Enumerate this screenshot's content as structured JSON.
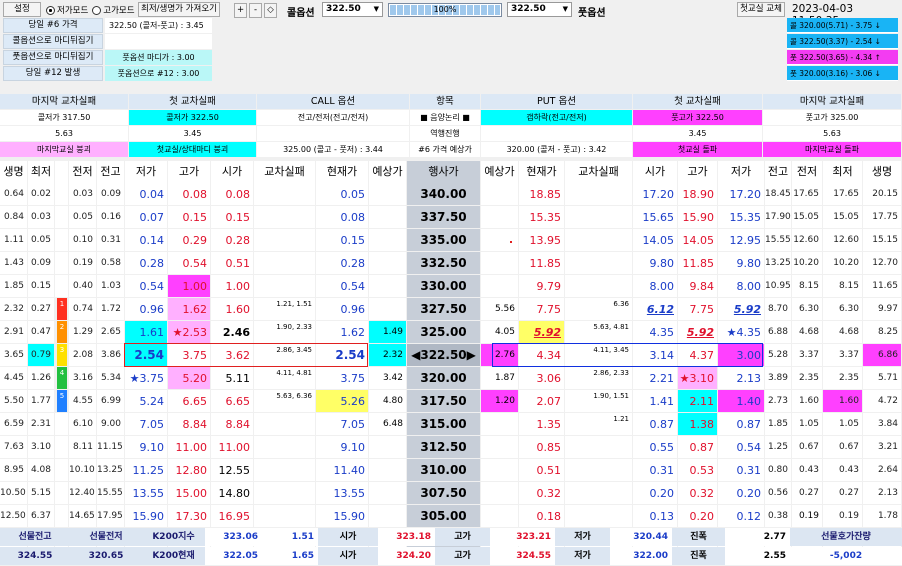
{
  "top": {
    "settings": "설정",
    "mode_low": "저가모드",
    "mode_high": "고가모드",
    "fetch_btn": "최저/생명가 가져오기",
    "plus": "+",
    "minus": "-",
    "diamond": "◇",
    "call_label": "콜옵션",
    "call_value": "322.50",
    "zoom": "100%",
    "put_value": "322.50",
    "put_label": "풋옵션",
    "replace_btn": "첫교실 교체",
    "datetime": "2023-04-03 11:50:35"
  },
  "info_rows": [
    {
      "label": "당일 #6 가격",
      "value": "322.50 (콜저-풋고) : 3.45",
      "hl": false
    },
    {
      "label": "콜옵션으로 마디뒤집기",
      "value": "",
      "hl": false
    },
    {
      "label": "풋옵션으로 마디뒤집기",
      "value": "풋옵션 마디가 : 3.00",
      "hl": true
    },
    {
      "label": "당일 #12 발생",
      "value": "풋옵션으로 #12 : 3.00",
      "hl": true
    }
  ],
  "side_list": [
    {
      "text": "콜 320.00(5.71) - 3.75 ↓",
      "color": "#19b4f5"
    },
    {
      "text": "콜 322.50(3.37) - 2.54 ↓",
      "color": "#19b4f5"
    },
    {
      "text": "풋 322.50(3.65) - 4.34 ↑",
      "color": "#f33cf2"
    },
    {
      "text": "풋 320.00(3.16) - 3.06 ↓",
      "color": "#19b4f5"
    }
  ],
  "header": {
    "row1": [
      "마지막 교차실패",
      "첫 교차실패",
      "CALL 옵션",
      "항목",
      "PUT 옵션",
      "첫 교차실패",
      "마지막 교차실패"
    ],
    "row2": [
      "콜저가 317.50",
      "콜저가 322.50",
      "전고/전저(전고/전저)",
      "■ 음양논리 ■",
      "갭하락(전고/전저)",
      "풋고가 322.50",
      "풋고가 325.00"
    ],
    "row3": [
      "5.63",
      "3.45",
      "",
      "역행진행",
      "",
      "3.45",
      "5.63"
    ],
    "row4": [
      "마지막교실 붕괴",
      "첫교실/상대마디 붕괴",
      "325.00 (콜고 - 풋저) : 3.44",
      "#6 가격 예상가",
      "320.00 (콜저 - 풋고) : 3.42",
      "첫교실 돌파",
      "마지막교실 돌파"
    ]
  },
  "cols": [
    "생명",
    "최저",
    "",
    "전저",
    "전고",
    "저가",
    "고가",
    "시가",
    "교차실패",
    "현재가",
    "예상가",
    "행사가",
    "예상가",
    "현재가",
    "교차실패",
    "시가",
    "고가",
    "저가",
    "전고",
    "전저",
    "최저",
    "생명"
  ],
  "rows": [
    {
      "strike": "340.00",
      "c": [
        "0.64",
        "0.02",
        "",
        "0.03",
        "0.09",
        "0.04",
        "0.08",
        "0.08",
        "",
        "0.05",
        ""
      ],
      "p": [
        "",
        "18.85",
        "",
        "17.20",
        "18.90",
        "17.20",
        "18.45",
        "17.65",
        "17.65",
        "20.15"
      ]
    },
    {
      "strike": "337.50",
      "c": [
        "0.84",
        "0.03",
        "",
        "0.05",
        "0.16",
        "0.07",
        "0.15",
        "0.15",
        "",
        "0.08",
        ""
      ],
      "p": [
        "",
        "15.35",
        "",
        "15.65",
        "15.90",
        "15.35",
        "17.90",
        "15.05",
        "15.05",
        "17.75"
      ]
    },
    {
      "strike": "335.00",
      "c": [
        "1.11",
        "0.05",
        "",
        "0.10",
        "0.31",
        "0.14",
        "0.29",
        "0.28",
        "",
        "0.15",
        ""
      ],
      "p": [
        "",
        "13.95",
        "",
        "14.05",
        "14.05",
        "12.95",
        "15.55",
        "12.60",
        "12.60",
        "15.15"
      ]
    },
    {
      "strike": "332.50",
      "c": [
        "1.43",
        "0.09",
        "",
        "0.19",
        "0.58",
        "0.28",
        "0.54",
        "0.51",
        "",
        "0.28",
        ""
      ],
      "p": [
        "",
        "11.85",
        "",
        "9.80",
        "11.85",
        "9.80",
        "13.25",
        "10.20",
        "10.20",
        "12.70"
      ]
    },
    {
      "strike": "330.00",
      "c": [
        "1.85",
        "0.15",
        "",
        "0.40",
        "1.03",
        "0.54",
        "1.00",
        "1.00",
        "",
        "0.54",
        ""
      ],
      "p": [
        "",
        "9.79",
        "",
        "8.00",
        "9.84",
        "8.00",
        "10.95",
        "8.15",
        "8.15",
        "11.65"
      ]
    },
    {
      "strike": "327.50",
      "c": [
        "2.32",
        "0.27",
        "1",
        "0.74",
        "1.72",
        "0.96",
        "1.62",
        "1.60",
        "1.21, 1.51",
        "0.96",
        ""
      ],
      "p": [
        "5.56",
        "7.75",
        "6.36",
        "6.12",
        "7.75",
        "5.92",
        "8.70",
        "6.30",
        "6.30",
        "9.97"
      ]
    },
    {
      "strike": "325.00",
      "c": [
        "2.91",
        "0.47",
        "2",
        "1.29",
        "2.65",
        "1.61",
        "★2.53",
        "2.46",
        "1.90, 2.33",
        "1.62",
        "1.49"
      ],
      "p": [
        "4.05",
        "5.92",
        "5.63, 4.81",
        "4.35",
        "5.92",
        "★4.35",
        "6.88",
        "4.68",
        "4.68",
        "8.25"
      ]
    },
    {
      "strike": "◀322.50▶",
      "c": [
        "3.65",
        "0.79",
        "3",
        "2.08",
        "3.86",
        "2.54",
        "3.75",
        "3.62",
        "2.86, 3.45",
        "2.54",
        "2.32"
      ],
      "p": [
        "2.76",
        "4.34",
        "4.11, 3.45",
        "3.14",
        "4.37",
        "3.00",
        "5.28",
        "3.37",
        "3.37",
        "6.86"
      ]
    },
    {
      "strike": "320.00",
      "c": [
        "4.45",
        "1.26",
        "4",
        "3.16",
        "5.34",
        "★3.75",
        "5.20",
        "5.11",
        "4.11, 4.81",
        "3.75",
        "3.42"
      ],
      "p": [
        "1.87",
        "3.06",
        "2.86, 2.33",
        "2.21",
        "★3.10",
        "2.13",
        "3.89",
        "2.35",
        "2.35",
        "5.71"
      ]
    },
    {
      "strike": "317.50",
      "c": [
        "5.50",
        "1.77",
        "5",
        "4.55",
        "6.99",
        "5.24",
        "6.65",
        "6.65",
        "5.63, 6.36",
        "5.26",
        "4.80"
      ],
      "p": [
        "1.20",
        "2.07",
        "1.90, 1.51",
        "1.41",
        "2.11",
        "1.40",
        "2.73",
        "1.60",
        "1.60",
        "4.72"
      ]
    },
    {
      "strike": "315.00",
      "c": [
        "6.59",
        "2.31",
        "",
        "6.10",
        "9.00",
        "7.05",
        "8.84",
        "8.84",
        "",
        "7.05",
        "6.48"
      ],
      "p": [
        "",
        "1.35",
        "1.21",
        "0.87",
        "1.38",
        "0.87",
        "1.85",
        "1.05",
        "1.05",
        "3.84"
      ]
    },
    {
      "strike": "312.50",
      "c": [
        "7.63",
        "3.10",
        "",
        "8.11",
        "11.15",
        "9.10",
        "11.00",
        "11.00",
        "",
        "9.10",
        ""
      ],
      "p": [
        "",
        "0.85",
        "",
        "0.55",
        "0.87",
        "0.54",
        "1.25",
        "0.67",
        "0.67",
        "3.21"
      ]
    },
    {
      "strike": "310.00",
      "c": [
        "8.95",
        "4.08",
        "",
        "10.10",
        "13.25",
        "11.25",
        "12.80",
        "12.55",
        "",
        "11.40",
        ""
      ],
      "p": [
        "",
        "0.51",
        "",
        "0.31",
        "0.53",
        "0.31",
        "0.80",
        "0.43",
        "0.43",
        "2.64"
      ]
    },
    {
      "strike": "307.50",
      "c": [
        "10.50",
        "5.15",
        "",
        "12.40",
        "15.55",
        "13.55",
        "15.00",
        "14.80",
        "",
        "13.55",
        ""
      ],
      "p": [
        "",
        "0.32",
        "",
        "0.20",
        "0.32",
        "0.20",
        "0.56",
        "0.27",
        "0.27",
        "2.13"
      ]
    },
    {
      "strike": "305.00",
      "c": [
        "12.50",
        "6.37",
        "",
        "14.65",
        "17.95",
        "15.90",
        "17.30",
        "16.95",
        "",
        "15.90",
        ""
      ],
      "p": [
        "",
        "0.18",
        "",
        "0.13",
        "0.20",
        "0.12",
        "0.38",
        "0.19",
        "0.19",
        "1.78"
      ]
    },
    {
      "strike": "302.50",
      "c": [
        "17.65",
        "7.54",
        "",
        "17.45",
        "20.30",
        "18.65",
        "20.30",
        "19.50",
        "",
        "18.65",
        ""
      ],
      "p": [
        "",
        "0.11",
        "",
        "0.08",
        "0.12",
        "0.08",
        "0.26",
        "0.11",
        "0.11",
        "1.57"
      ]
    }
  ],
  "bottom": {
    "r1": [
      [
        "선물전고",
        ""
      ],
      [
        "선물전저",
        ""
      ],
      [
        "K200지수",
        "323.06"
      ],
      [
        "",
        "1.51"
      ],
      [
        "시가",
        "323.18"
      ],
      [
        "고가",
        "323.21"
      ],
      [
        "저가",
        "320.44"
      ],
      [
        "진폭",
        "2.77"
      ],
      [
        "선물호가잔량",
        ""
      ]
    ],
    "r2": [
      [
        "324.55",
        ""
      ],
      [
        "320.65",
        ""
      ],
      [
        "K200현재",
        "322.05"
      ],
      [
        "",
        "1.65"
      ],
      [
        "시가",
        "324.20"
      ],
      [
        "고가",
        "324.55"
      ],
      [
        "저가",
        "322.00"
      ],
      [
        "진폭",
        "2.55"
      ],
      [
        "-5,002",
        ""
      ]
    ]
  },
  "colors": {
    "cyan": "#00ffff",
    "magenta": "#ff40ff",
    "yellow": "#ffff66",
    "pink": "#ffb0ff",
    "blue": "#1a3cc8",
    "red": "#e0102c",
    "gray": "#c8c8c8"
  }
}
